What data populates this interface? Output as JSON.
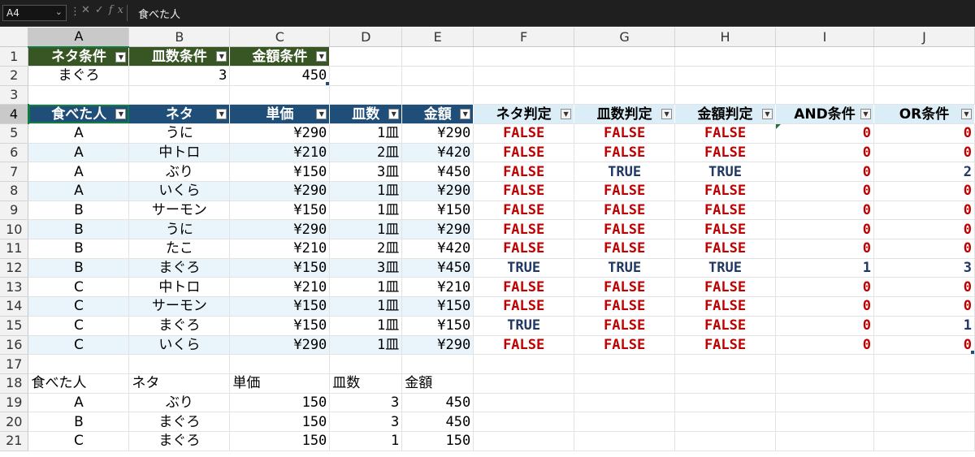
{
  "formula_bar": {
    "name_box": "A4",
    "formula": "食べた人"
  },
  "columns": [
    "A",
    "B",
    "C",
    "D",
    "E",
    "F",
    "G",
    "H",
    "I",
    "J"
  ],
  "rows": [
    "1",
    "2",
    "3",
    "4",
    "5",
    "6",
    "7",
    "8",
    "9",
    "10",
    "11",
    "12",
    "13",
    "14",
    "15",
    "16",
    "17",
    "18",
    "19",
    "20",
    "21"
  ],
  "conditions": {
    "headers": [
      "ネタ条件",
      "皿数条件",
      "金額条件"
    ],
    "values": [
      "まぐろ",
      "3",
      "450"
    ]
  },
  "main_table": {
    "headers": [
      "食べた人",
      "ネタ",
      "単価",
      "皿数",
      "金額",
      "ネタ判定",
      "皿数判定",
      "金額判定",
      "AND条件",
      "OR条件"
    ],
    "rows": [
      [
        "A",
        "うに",
        "¥290",
        "1皿",
        "¥290",
        "FALSE",
        "FALSE",
        "FALSE",
        "0",
        "0"
      ],
      [
        "A",
        "中トロ",
        "¥210",
        "2皿",
        "¥420",
        "FALSE",
        "FALSE",
        "FALSE",
        "0",
        "0"
      ],
      [
        "A",
        "ぶり",
        "¥150",
        "3皿",
        "¥450",
        "FALSE",
        "TRUE",
        "TRUE",
        "0",
        "2"
      ],
      [
        "A",
        "いくら",
        "¥290",
        "1皿",
        "¥290",
        "FALSE",
        "FALSE",
        "FALSE",
        "0",
        "0"
      ],
      [
        "B",
        "サーモン",
        "¥150",
        "1皿",
        "¥150",
        "FALSE",
        "FALSE",
        "FALSE",
        "0",
        "0"
      ],
      [
        "B",
        "うに",
        "¥290",
        "1皿",
        "¥290",
        "FALSE",
        "FALSE",
        "FALSE",
        "0",
        "0"
      ],
      [
        "B",
        "たこ",
        "¥210",
        "2皿",
        "¥420",
        "FALSE",
        "FALSE",
        "FALSE",
        "0",
        "0"
      ],
      [
        "B",
        "まぐろ",
        "¥150",
        "3皿",
        "¥450",
        "TRUE",
        "TRUE",
        "TRUE",
        "1",
        "3"
      ],
      [
        "C",
        "中トロ",
        "¥210",
        "1皿",
        "¥210",
        "FALSE",
        "FALSE",
        "FALSE",
        "0",
        "0"
      ],
      [
        "C",
        "サーモン",
        "¥150",
        "1皿",
        "¥150",
        "FALSE",
        "FALSE",
        "FALSE",
        "0",
        "0"
      ],
      [
        "C",
        "まぐろ",
        "¥150",
        "1皿",
        "¥150",
        "TRUE",
        "FALSE",
        "FALSE",
        "0",
        "1"
      ],
      [
        "C",
        "いくら",
        "¥290",
        "1皿",
        "¥290",
        "FALSE",
        "FALSE",
        "FALSE",
        "0",
        "0"
      ]
    ]
  },
  "result_table": {
    "headers": [
      "食べた人",
      "ネタ",
      "単価",
      "皿数",
      "金額"
    ],
    "rows": [
      [
        "A",
        "ぶり",
        "150",
        "3",
        "450"
      ],
      [
        "B",
        "まぐろ",
        "150",
        "3",
        "450"
      ],
      [
        "C",
        "まぐろ",
        "150",
        "1",
        "150"
      ]
    ]
  },
  "colors": {
    "green_header": "#375623",
    "navy_header": "#1f4e78",
    "light_header": "#dbeef8",
    "false_red": "#c00000",
    "true_navy": "#1f3864",
    "band": "#eaf4fb"
  }
}
